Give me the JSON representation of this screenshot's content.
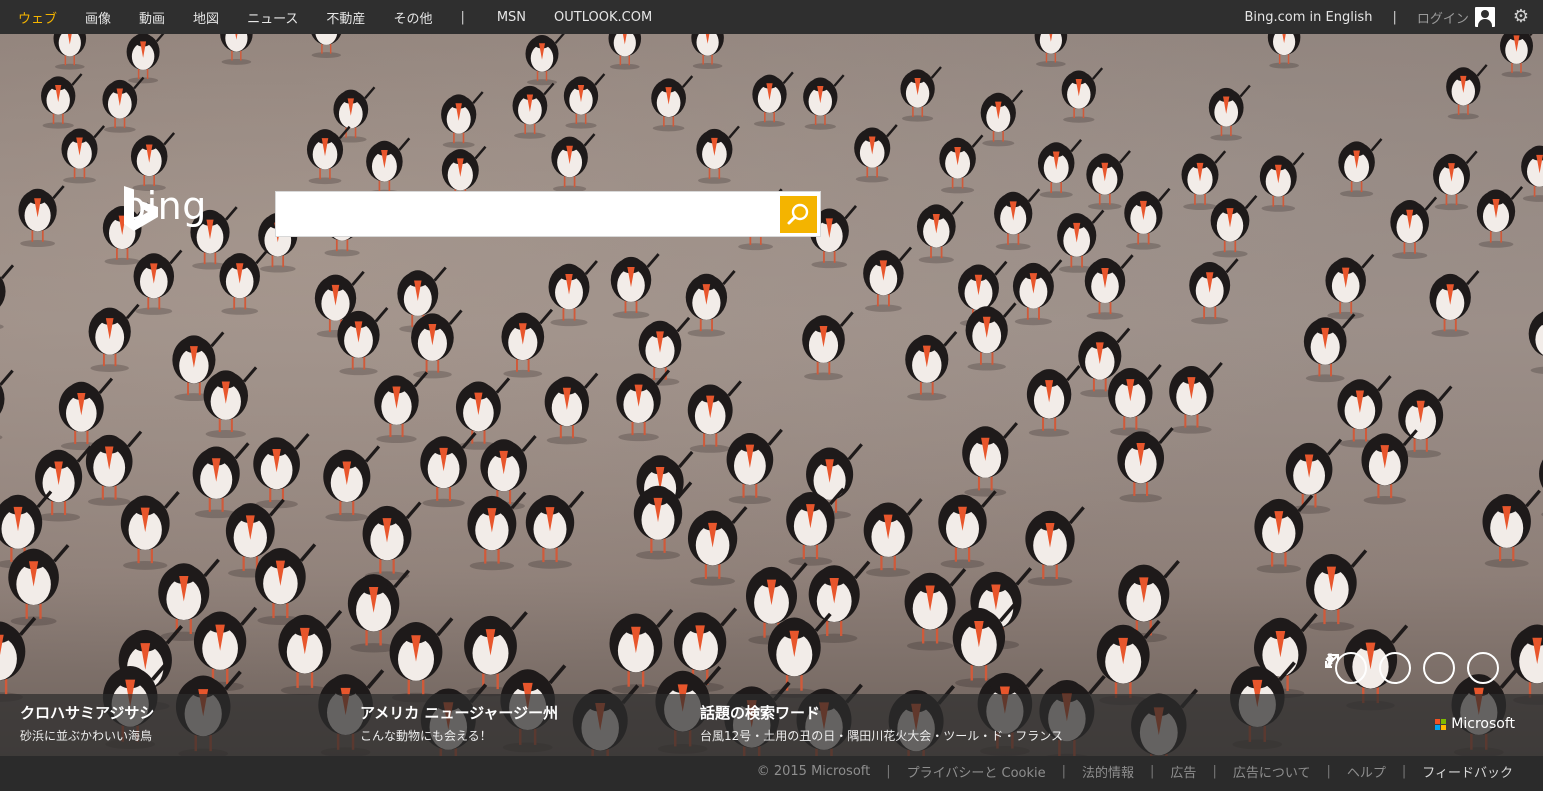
{
  "topnav": {
    "items": [
      "ウェブ",
      "画像",
      "動画",
      "地図",
      "ニュース",
      "不動産",
      "その他"
    ],
    "active_color": "#f4b400",
    "separator": "|",
    "extra": [
      "MSN",
      "OUTLOOK.COM"
    ],
    "english_link": "Bing.com in English",
    "right_separator": "|",
    "login": "ログイン",
    "settings_icon": "gear-icon",
    "user_icon": "user-icon"
  },
  "logo": {
    "text": "bing"
  },
  "search": {
    "value": "",
    "button_icon": "search-icon",
    "button_color": "#f4b400"
  },
  "image_controls": [
    "fullscreen-icon",
    "chevron-left-icon",
    "chevron-right-icon",
    "info-icon"
  ],
  "captions": [
    {
      "title": "クロハサミアジサシ",
      "subtitle": "砂浜に並ぶかわいい海鳥"
    },
    {
      "title": "アメリカ ニュージャージー州",
      "subtitle": "こんな動物にも会える！"
    },
    {
      "title": "話題の検索ワード",
      "subtitle": "台風12号・土用の丑の日・隅田川花火大会・ツール・ド・フランス"
    }
  ],
  "microsoft": {
    "text": "Microsoft",
    "colors": [
      "#f25022",
      "#7fba00",
      "#00a4ef",
      "#ffb900"
    ]
  },
  "footer": {
    "copyright": "© 2015 Microsoft",
    "links": [
      "プライバシーと Cookie",
      "法的情報",
      "広告",
      "広告について",
      "ヘルプ"
    ],
    "feedback": "フィードバック",
    "separator": "|"
  }
}
